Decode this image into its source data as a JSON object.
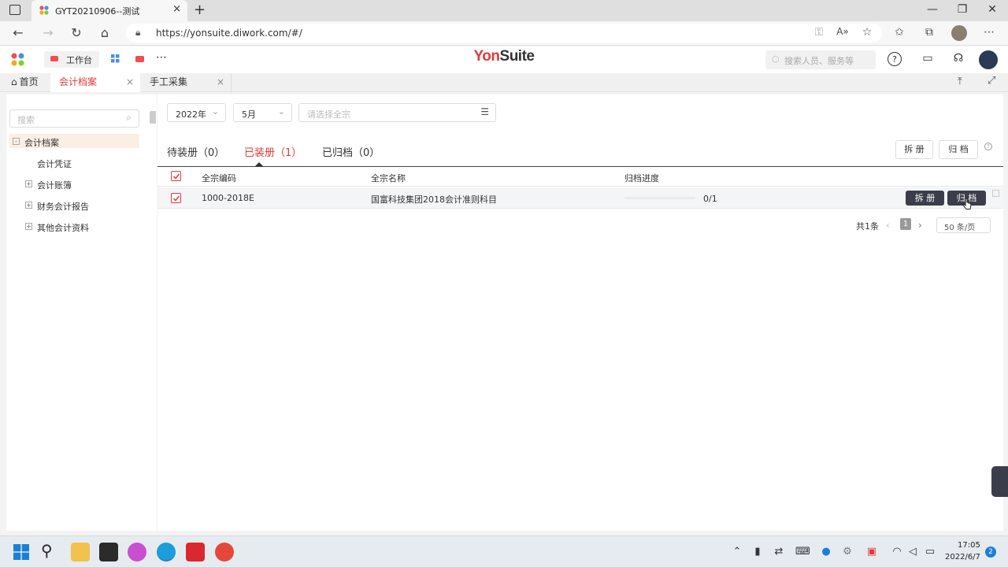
{
  "browser": {
    "tab_title": "GYT20210906--测试",
    "url": "https://yonsuite.diwork.com/#/",
    "close_glyph": "×",
    "new_tab_glyph": "+"
  },
  "app_header": {
    "logo_yon": "Yon",
    "logo_suite": "Suite",
    "workbench_label": "工作台",
    "search_placeholder": "搜索人员、服务等"
  },
  "app_tabs": [
    {
      "label": "首页"
    },
    {
      "label": "会计档案",
      "active": true
    },
    {
      "label": "手工采集"
    }
  ],
  "sidebar": {
    "search_placeholder": "搜索",
    "tree": [
      {
        "label": "会计档案",
        "toggle": "-",
        "selected": true
      },
      {
        "label": "会计凭证"
      },
      {
        "label": "会计账簿",
        "toggle": "+"
      },
      {
        "label": "财务会计报告",
        "toggle": "+"
      },
      {
        "label": "其他会计资料",
        "toggle": "+"
      }
    ]
  },
  "filters": {
    "year": "2022年",
    "month": "5月",
    "fonds_placeholder": "请选择全宗"
  },
  "status_tabs": [
    {
      "label": "待装册（0）"
    },
    {
      "label": "已装册（1）",
      "active": true
    },
    {
      "label": "已归档（0）"
    }
  ],
  "actions": {
    "unbind": "拆 册",
    "archive": "归 档"
  },
  "table": {
    "headers": [
      "全宗编码",
      "全宗名称",
      "归档进度"
    ],
    "rows": [
      {
        "code": "1000-2018E",
        "name": "国富科技集团2018会计准则科目",
        "progress_text": "0/1",
        "progress": 0,
        "checked": true
      }
    ]
  },
  "pagination": {
    "total": "共1条",
    "current_page": "1",
    "page_size": "50 条/页"
  },
  "taskbar": {
    "time": "17:05",
    "date": "2022/6/7",
    "notifications": "2"
  },
  "colors": {
    "accent": "#e4393c",
    "dark_button": "#3b3e4a",
    "selected_tree_bg": "#fbeee2"
  }
}
